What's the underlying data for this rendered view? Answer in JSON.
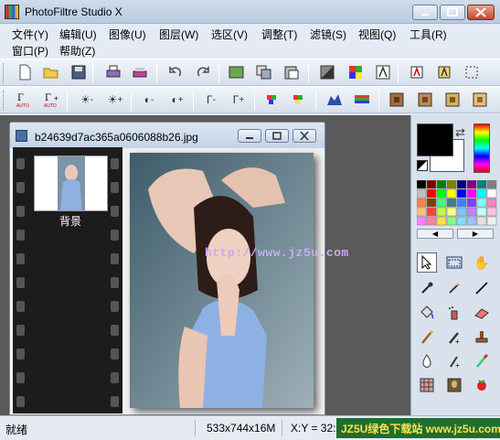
{
  "app": {
    "title": "PhotoFiltre Studio X"
  },
  "menu": {
    "row1": [
      "文件(Y)",
      "编辑(U)",
      "图像(U)",
      "图层(W)",
      "选区(V)",
      "调整(T)",
      "滤镜(S)",
      "视图(Q)",
      "工具(R)"
    ],
    "row2": [
      "窗口(P)",
      "帮助(Z)"
    ]
  },
  "document": {
    "filename": "b24639d7ac365a0606088b26.jpg",
    "layer_label": "背景",
    "watermark_url": "http://www.jz5u.com"
  },
  "status": {
    "ready": "就绪",
    "size": "533x744x16M",
    "coords": "X:Y = 32:"
  },
  "watermark_logo": "JZ5U绿色下载站 www.jz5u.com",
  "colors": {
    "foreground": "#000000",
    "background": "#ffffff",
    "accent": "#1e6f2f"
  },
  "icons": {
    "toolbar1": [
      "new-file-icon",
      "open-folder-icon",
      "save-icon",
      "print-icon",
      "scan-icon",
      "undo-icon",
      "redo-icon",
      "paste-as-image-icon",
      "copy-icon",
      "paste-icon",
      "fill-icon",
      "color-palette-icon",
      "transparency-icon",
      "crop-icon",
      "fit-icon",
      "select-icon"
    ],
    "toolbar2": [
      "gamma-auto-icon",
      "gamma-auto-plus-icon",
      "brightness-minus-icon",
      "brightness-plus-icon",
      "contrast-minus-icon",
      "contrast-plus-icon",
      "gamma-minus-icon",
      "gamma-plus-icon",
      "saturation-minus-icon",
      "saturation-plus-icon",
      "levels-icon",
      "rgb-icon",
      "filter-1-icon",
      "filter-2-icon",
      "filter-3-icon",
      "filter-4-icon"
    ],
    "tools": [
      "pointer-tool-icon",
      "selection-tool-icon",
      "hand-tool-icon",
      "pipette-icon",
      "magic-wand-icon",
      "line-icon",
      "bucket-icon",
      "spray-icon",
      "eraser-icon",
      "brush-icon",
      "effect-brush-icon",
      "stamp-icon",
      "drop-icon",
      "finger-icon",
      "clone-icon",
      "pattern-icon",
      "mona-lisa-icon",
      "strawberry-icon"
    ]
  }
}
